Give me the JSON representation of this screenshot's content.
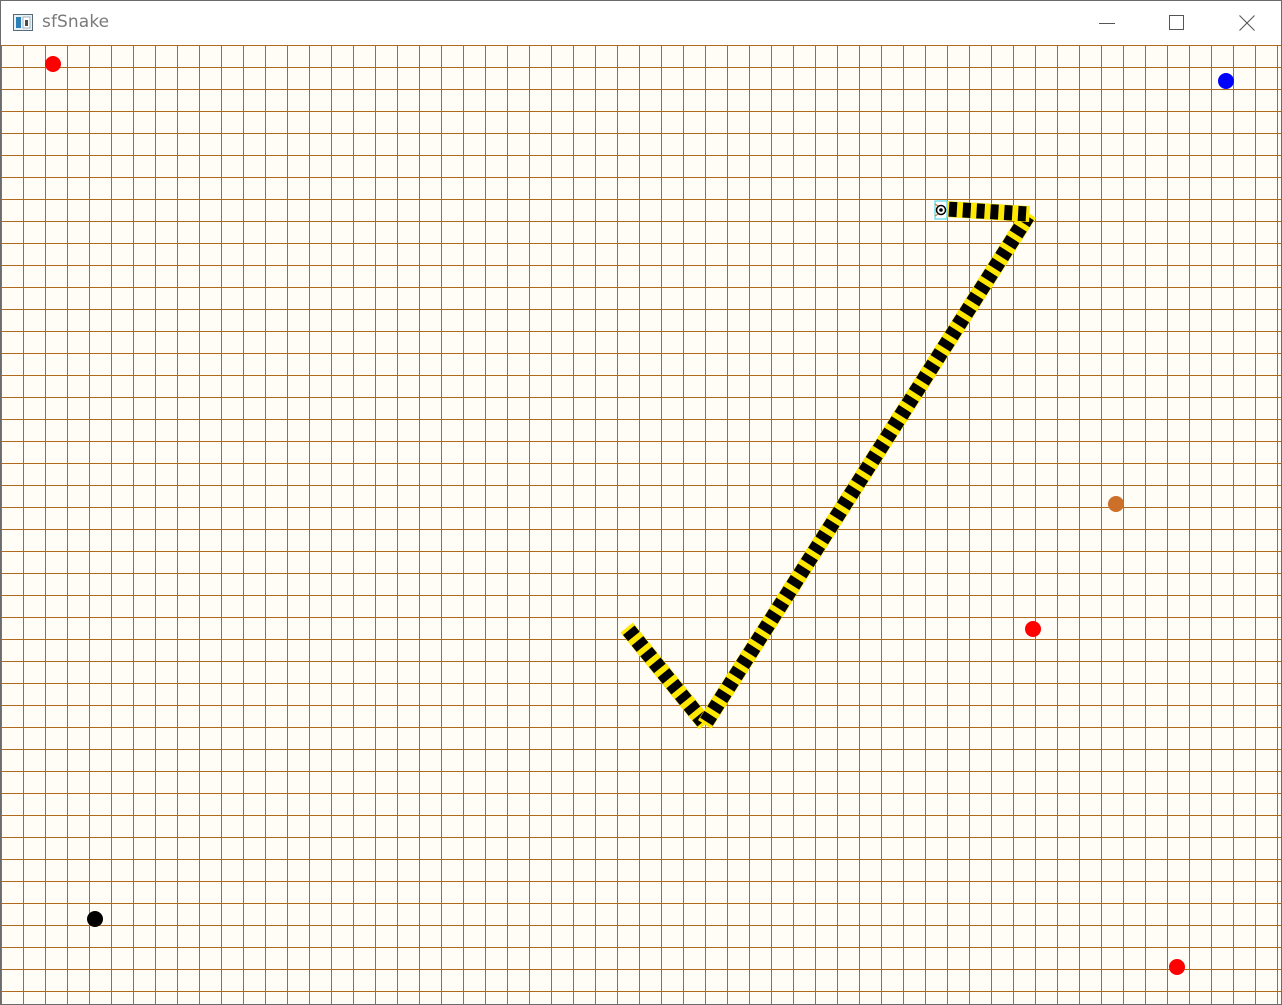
{
  "window": {
    "title": "sfSnake",
    "icons": {
      "app": "app-window-icon",
      "minimize": "minimize-icon",
      "maximize": "maximize-icon",
      "close": "close-icon"
    }
  },
  "game": {
    "colors": {
      "background": "#fffdf6",
      "grid": "#b06a1e",
      "snake_stripe": "#ffe800",
      "snake_band": "#000000",
      "head": "#ffffff",
      "head_outline": "#55d6e8"
    },
    "fruits": [
      {
        "color": "#ff0000",
        "name": "red"
      },
      {
        "color": "#0000ff",
        "name": "blue"
      },
      {
        "color": "#cc6f28",
        "name": "brown"
      },
      {
        "color": "#ff0000",
        "name": "red"
      },
      {
        "color": "#000000",
        "name": "black"
      },
      {
        "color": "#ff0000",
        "name": "red"
      }
    ]
  }
}
